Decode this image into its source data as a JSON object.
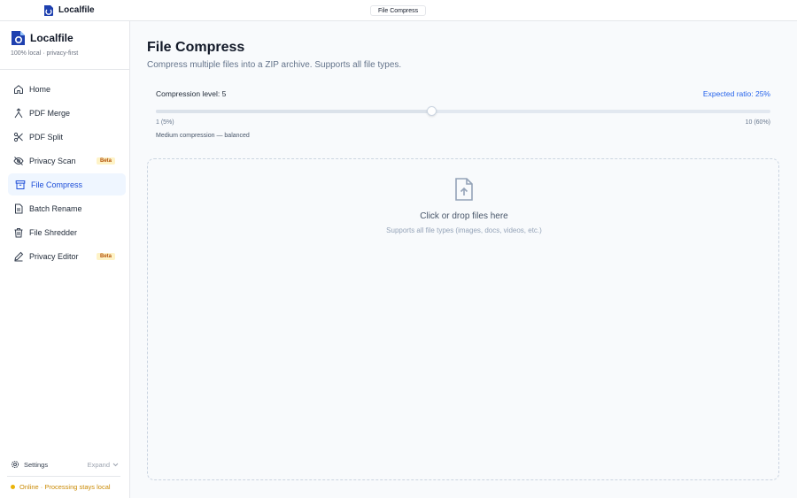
{
  "window": {
    "app_name": "Localfile",
    "tab_label": "File Compress"
  },
  "sidebar": {
    "brand_name": "Localfile",
    "brand_tagline": "100% local · privacy-first",
    "items": [
      {
        "label": "Home",
        "icon": "home-icon"
      },
      {
        "label": "PDF Merge",
        "icon": "merge-icon"
      },
      {
        "label": "PDF Split",
        "icon": "scissors-icon"
      },
      {
        "label": "Privacy Scan",
        "icon": "eye-off-icon",
        "badge": "Beta"
      },
      {
        "label": "File Compress",
        "icon": "archive-icon",
        "active": true
      },
      {
        "label": "Batch Rename",
        "icon": "document-icon"
      },
      {
        "label": "File Shredder",
        "icon": "trash-icon"
      },
      {
        "label": "Privacy Editor",
        "icon": "pencil-icon",
        "badge": "Beta"
      }
    ],
    "settings_label": "Settings",
    "expand_label": "Expand",
    "status_text": "Online · Processing stays local"
  },
  "main": {
    "title": "File Compress",
    "subtitle": "Compress multiple files into a ZIP archive. Supports all file types.",
    "compression_label": "Compression level: 5",
    "expected_ratio": "Expected ratio: 25%",
    "slider": {
      "min": 1,
      "max": 10,
      "value": 5
    },
    "min_label": "1 (5%)",
    "max_label": "10 (60%)",
    "level_hint": "Medium compression — balanced",
    "dropzone_title": "Click or drop files here",
    "dropzone_subtitle": "Supports all file types (images, docs, videos, etc.)"
  },
  "colors": {
    "accent": "#2563eb",
    "active_bg": "#eff6ff",
    "badge_bg": "#fef3c7",
    "badge_text": "#b45309",
    "status": "#ca8a04"
  }
}
